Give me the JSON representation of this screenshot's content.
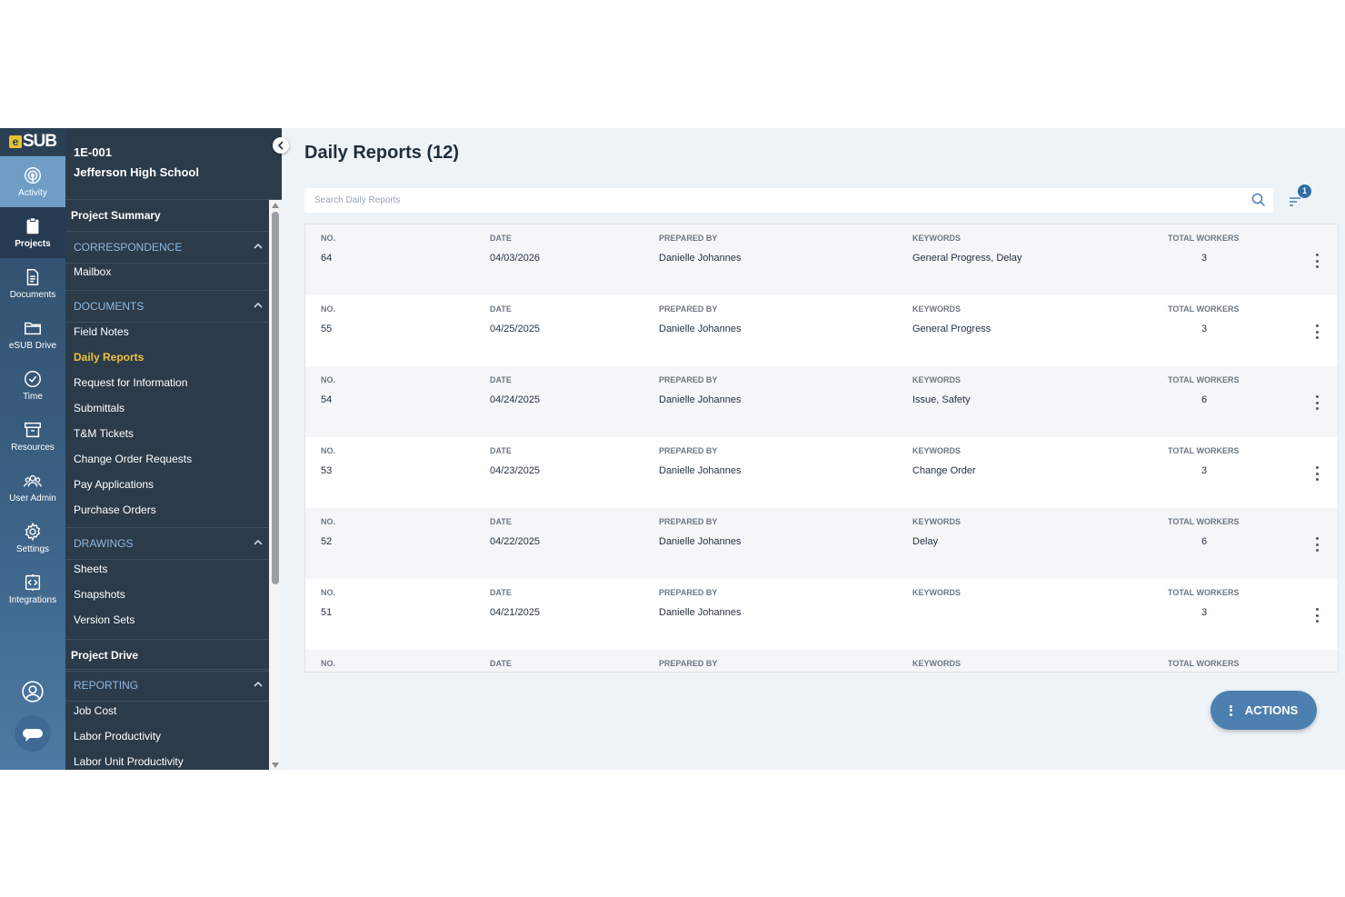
{
  "brand": {
    "logo_mark": "e",
    "logo_text": "SUB"
  },
  "rail": [
    {
      "label": "Activity",
      "icon": "activity-icon"
    },
    {
      "label": "Projects",
      "icon": "clipboard-icon"
    },
    {
      "label": "Documents",
      "icon": "document-icon"
    },
    {
      "label": "eSUB Drive",
      "icon": "folder-icon"
    },
    {
      "label": "Time",
      "icon": "clock-icon"
    },
    {
      "label": "Resources",
      "icon": "box-icon"
    },
    {
      "label": "User Admin",
      "icon": "users-icon"
    },
    {
      "label": "Settings",
      "icon": "gear-icon"
    },
    {
      "label": "Integrations",
      "icon": "integrations-icon"
    }
  ],
  "project": {
    "number": "1E-001",
    "name": "Jefferson High School"
  },
  "nav": {
    "project_summary": "Project Summary",
    "correspondence": {
      "title": "CORRESPONDENCE",
      "items": [
        "Mailbox"
      ]
    },
    "documents": {
      "title": "DOCUMENTS",
      "items": [
        "Field Notes",
        "Daily Reports",
        "Request for Information",
        "Submittals",
        "T&M Tickets",
        "Change Order Requests",
        "Pay Applications",
        "Purchase Orders"
      ]
    },
    "drawings": {
      "title": "DRAWINGS",
      "items": [
        "Sheets",
        "Snapshots",
        "Version Sets"
      ]
    },
    "project_drive": "Project Drive",
    "reporting": {
      "title": "REPORTING",
      "items": [
        "Job Cost",
        "Labor Productivity",
        "Labor Unit Productivity"
      ]
    }
  },
  "page": {
    "title": "Daily Reports (12)"
  },
  "search": {
    "placeholder": "Search Daily Reports"
  },
  "filter": {
    "badge": "1"
  },
  "columns": {
    "no": "NO.",
    "date": "DATE",
    "prepared_by": "PREPARED BY",
    "keywords": "KEYWORDS",
    "total_workers": "TOTAL WORKERS"
  },
  "rows": [
    {
      "no": "64",
      "date": "04/03/2026",
      "prepared_by": "Danielle Johannes",
      "keywords": "General Progress, Delay",
      "total_workers": "3"
    },
    {
      "no": "55",
      "date": "04/25/2025",
      "prepared_by": "Danielle Johannes",
      "keywords": "General Progress",
      "total_workers": "3"
    },
    {
      "no": "54",
      "date": "04/24/2025",
      "prepared_by": "Danielle Johannes",
      "keywords": "Issue, Safety",
      "total_workers": "6"
    },
    {
      "no": "53",
      "date": "04/23/2025",
      "prepared_by": "Danielle Johannes",
      "keywords": "Change Order",
      "total_workers": "3"
    },
    {
      "no": "52",
      "date": "04/22/2025",
      "prepared_by": "Danielle Johannes",
      "keywords": "Delay",
      "total_workers": "6"
    },
    {
      "no": "51",
      "date": "04/21/2025",
      "prepared_by": "Danielle Johannes",
      "keywords": "",
      "total_workers": "3"
    },
    {
      "no": "",
      "date": "",
      "prepared_by": "",
      "keywords": "",
      "total_workers": ""
    }
  ],
  "actions": {
    "label": "ACTIONS"
  },
  "colors": {
    "accent": "#4d80b0",
    "current_nav": "#f0c23a",
    "section_header": "#8fb8e0",
    "panel_bg": "#2c3b4a"
  }
}
